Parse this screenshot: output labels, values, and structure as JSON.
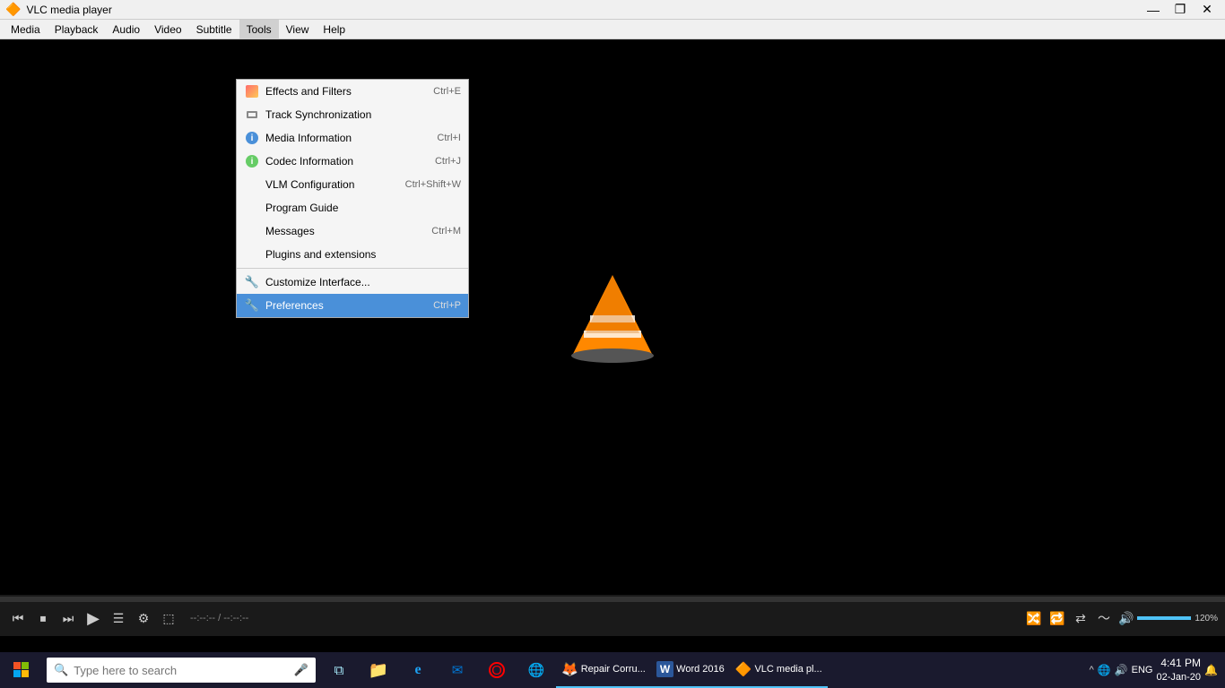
{
  "titlebar": {
    "title": "VLC media player",
    "icon": "▶",
    "minimize_label": "—",
    "restore_label": "❐",
    "close_label": "✕"
  },
  "menubar": {
    "items": [
      {
        "label": "Media",
        "id": "media"
      },
      {
        "label": "Playback",
        "id": "playback"
      },
      {
        "label": "Audio",
        "id": "audio"
      },
      {
        "label": "Video",
        "id": "video"
      },
      {
        "label": "Subtitle",
        "id": "subtitle"
      },
      {
        "label": "Tools",
        "id": "tools"
      },
      {
        "label": "View",
        "id": "view"
      },
      {
        "label": "Help",
        "id": "help"
      }
    ]
  },
  "tools_menu": {
    "items": [
      {
        "id": "effects",
        "label": "Effects and Filters",
        "shortcut": "Ctrl+E",
        "icon_type": "effects",
        "separator_after": false
      },
      {
        "id": "track_sync",
        "label": "Track Synchronization",
        "shortcut": "",
        "icon_type": "sync",
        "separator_after": false
      },
      {
        "id": "media_info",
        "label": "Media Information",
        "shortcut": "Ctrl+I",
        "icon_type": "info",
        "separator_after": false
      },
      {
        "id": "codec_info",
        "label": "Codec Information",
        "shortcut": "Ctrl+J",
        "icon_type": "codec",
        "separator_after": false
      },
      {
        "id": "vlm",
        "label": "VLM Configuration",
        "shortcut": "Ctrl+Shift+W",
        "icon_type": "",
        "separator_after": false
      },
      {
        "id": "program_guide",
        "label": "Program Guide",
        "shortcut": "",
        "icon_type": "",
        "separator_after": false
      },
      {
        "id": "messages",
        "label": "Messages",
        "shortcut": "Ctrl+M",
        "icon_type": "",
        "separator_after": false
      },
      {
        "id": "plugins",
        "label": "Plugins and extensions",
        "shortcut": "",
        "icon_type": "",
        "separator_after": true
      },
      {
        "id": "customize",
        "label": "Customize Interface...",
        "shortcut": "",
        "icon_type": "wrench",
        "separator_after": false
      },
      {
        "id": "preferences",
        "label": "Preferences",
        "shortcut": "Ctrl+P",
        "icon_type": "prefs",
        "highlighted": true,
        "separator_after": false
      }
    ]
  },
  "controls": {
    "seek_position": 0,
    "volume": 100,
    "volume_pct": "120%",
    "time": "--:--:-- / --:--:--"
  },
  "taskbar": {
    "search_placeholder": "Type here to search",
    "apps": [
      {
        "label": "Task View",
        "icon": "⧉"
      },
      {
        "label": "File Explorer",
        "icon": "📁"
      },
      {
        "label": "Edge",
        "icon": "e"
      },
      {
        "label": "Mail",
        "icon": "✉"
      },
      {
        "label": "Opera",
        "icon": "O"
      },
      {
        "label": "Edge2",
        "icon": "🌐"
      },
      {
        "label": "Repair Corru...",
        "icon": "🦊"
      },
      {
        "label": "Word 2016",
        "icon": "W"
      },
      {
        "label": "VLC media pl...",
        "icon": "🔶"
      }
    ],
    "system_tray": {
      "show_hidden": "^",
      "language": "ENG",
      "time": "4:41 PM",
      "date": "02-Jan-20"
    }
  }
}
